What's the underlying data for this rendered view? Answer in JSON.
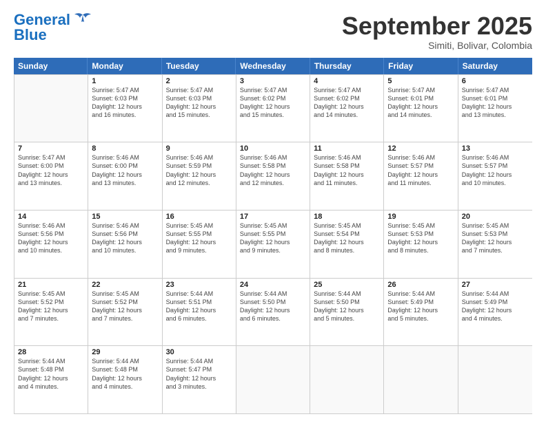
{
  "header": {
    "logo_line1": "General",
    "logo_line2": "Blue",
    "month": "September 2025",
    "location": "Simiti, Bolivar, Colombia"
  },
  "weekdays": [
    "Sunday",
    "Monday",
    "Tuesday",
    "Wednesday",
    "Thursday",
    "Friday",
    "Saturday"
  ],
  "rows": [
    [
      {
        "day": "",
        "info": ""
      },
      {
        "day": "1",
        "info": "Sunrise: 5:47 AM\nSunset: 6:03 PM\nDaylight: 12 hours\nand 16 minutes."
      },
      {
        "day": "2",
        "info": "Sunrise: 5:47 AM\nSunset: 6:03 PM\nDaylight: 12 hours\nand 15 minutes."
      },
      {
        "day": "3",
        "info": "Sunrise: 5:47 AM\nSunset: 6:02 PM\nDaylight: 12 hours\nand 15 minutes."
      },
      {
        "day": "4",
        "info": "Sunrise: 5:47 AM\nSunset: 6:02 PM\nDaylight: 12 hours\nand 14 minutes."
      },
      {
        "day": "5",
        "info": "Sunrise: 5:47 AM\nSunset: 6:01 PM\nDaylight: 12 hours\nand 14 minutes."
      },
      {
        "day": "6",
        "info": "Sunrise: 5:47 AM\nSunset: 6:01 PM\nDaylight: 12 hours\nand 13 minutes."
      }
    ],
    [
      {
        "day": "7",
        "info": "Sunrise: 5:47 AM\nSunset: 6:00 PM\nDaylight: 12 hours\nand 13 minutes."
      },
      {
        "day": "8",
        "info": "Sunrise: 5:46 AM\nSunset: 6:00 PM\nDaylight: 12 hours\nand 13 minutes."
      },
      {
        "day": "9",
        "info": "Sunrise: 5:46 AM\nSunset: 5:59 PM\nDaylight: 12 hours\nand 12 minutes."
      },
      {
        "day": "10",
        "info": "Sunrise: 5:46 AM\nSunset: 5:58 PM\nDaylight: 12 hours\nand 12 minutes."
      },
      {
        "day": "11",
        "info": "Sunrise: 5:46 AM\nSunset: 5:58 PM\nDaylight: 12 hours\nand 11 minutes."
      },
      {
        "day": "12",
        "info": "Sunrise: 5:46 AM\nSunset: 5:57 PM\nDaylight: 12 hours\nand 11 minutes."
      },
      {
        "day": "13",
        "info": "Sunrise: 5:46 AM\nSunset: 5:57 PM\nDaylight: 12 hours\nand 10 minutes."
      }
    ],
    [
      {
        "day": "14",
        "info": "Sunrise: 5:46 AM\nSunset: 5:56 PM\nDaylight: 12 hours\nand 10 minutes."
      },
      {
        "day": "15",
        "info": "Sunrise: 5:46 AM\nSunset: 5:56 PM\nDaylight: 12 hours\nand 10 minutes."
      },
      {
        "day": "16",
        "info": "Sunrise: 5:45 AM\nSunset: 5:55 PM\nDaylight: 12 hours\nand 9 minutes."
      },
      {
        "day": "17",
        "info": "Sunrise: 5:45 AM\nSunset: 5:55 PM\nDaylight: 12 hours\nand 9 minutes."
      },
      {
        "day": "18",
        "info": "Sunrise: 5:45 AM\nSunset: 5:54 PM\nDaylight: 12 hours\nand 8 minutes."
      },
      {
        "day": "19",
        "info": "Sunrise: 5:45 AM\nSunset: 5:53 PM\nDaylight: 12 hours\nand 8 minutes."
      },
      {
        "day": "20",
        "info": "Sunrise: 5:45 AM\nSunset: 5:53 PM\nDaylight: 12 hours\nand 7 minutes."
      }
    ],
    [
      {
        "day": "21",
        "info": "Sunrise: 5:45 AM\nSunset: 5:52 PM\nDaylight: 12 hours\nand 7 minutes."
      },
      {
        "day": "22",
        "info": "Sunrise: 5:45 AM\nSunset: 5:52 PM\nDaylight: 12 hours\nand 7 minutes."
      },
      {
        "day": "23",
        "info": "Sunrise: 5:44 AM\nSunset: 5:51 PM\nDaylight: 12 hours\nand 6 minutes."
      },
      {
        "day": "24",
        "info": "Sunrise: 5:44 AM\nSunset: 5:50 PM\nDaylight: 12 hours\nand 6 minutes."
      },
      {
        "day": "25",
        "info": "Sunrise: 5:44 AM\nSunset: 5:50 PM\nDaylight: 12 hours\nand 5 minutes."
      },
      {
        "day": "26",
        "info": "Sunrise: 5:44 AM\nSunset: 5:49 PM\nDaylight: 12 hours\nand 5 minutes."
      },
      {
        "day": "27",
        "info": "Sunrise: 5:44 AM\nSunset: 5:49 PM\nDaylight: 12 hours\nand 4 minutes."
      }
    ],
    [
      {
        "day": "28",
        "info": "Sunrise: 5:44 AM\nSunset: 5:48 PM\nDaylight: 12 hours\nand 4 minutes."
      },
      {
        "day": "29",
        "info": "Sunrise: 5:44 AM\nSunset: 5:48 PM\nDaylight: 12 hours\nand 4 minutes."
      },
      {
        "day": "30",
        "info": "Sunrise: 5:44 AM\nSunset: 5:47 PM\nDaylight: 12 hours\nand 3 minutes."
      },
      {
        "day": "",
        "info": ""
      },
      {
        "day": "",
        "info": ""
      },
      {
        "day": "",
        "info": ""
      },
      {
        "day": "",
        "info": ""
      }
    ]
  ]
}
